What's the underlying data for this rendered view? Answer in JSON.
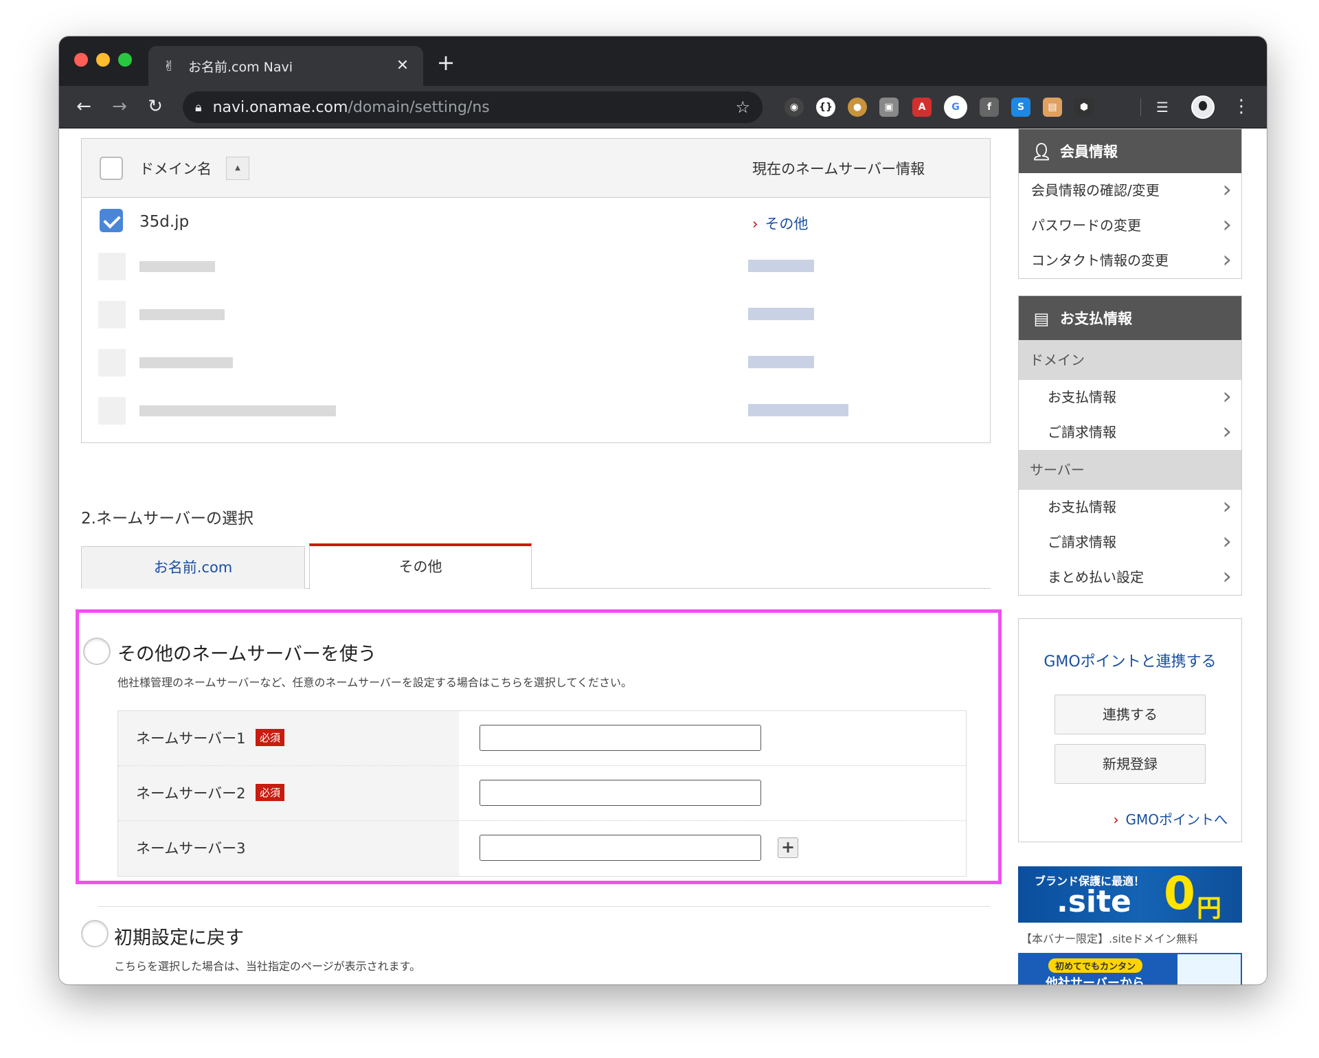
{
  "browser": {
    "tab_title": "お名前.com Navi",
    "tab_close": "✕",
    "new_tab": "+",
    "url_host": "navi.onamae.com",
    "url_path": "/domain/setting/ns",
    "extensions": [
      "adblock-icon",
      "code-icon",
      "cookie-icon",
      "screen-icon",
      "angular-icon",
      "google-icon",
      "facebook-icon",
      "stylus-icon",
      "reader-icon",
      "shield-icon"
    ]
  },
  "domain_table": {
    "col_domain": "ドメイン名",
    "col_ns": "現在のネームサーバー情報",
    "rows": [
      {
        "name": "35d.jp",
        "ns": "その他",
        "checked": true
      }
    ]
  },
  "section2": {
    "title": "2.ネームサーバーの選択",
    "tabs": [
      "お名前.com",
      "その他"
    ],
    "option_other": {
      "title": "その他のネームサーバーを使う",
      "desc": "他社様管理のネームサーバーなど、任意のネームサーバーを設定する場合はこちらを選択してください。"
    },
    "ns_rows": [
      {
        "label": "ネームサーバー1",
        "badge": "必須",
        "value": ""
      },
      {
        "label": "ネームサーバー2",
        "badge": "必須",
        "value": ""
      },
      {
        "label": "ネームサーバー3",
        "badge": "",
        "value": ""
      }
    ],
    "option_default": {
      "title": "初期設定に戻す",
      "desc": "こちらを選択した場合は、当社指定のページが表示されます。"
    }
  },
  "sidebar": {
    "member": {
      "title": "会員情報",
      "links": [
        "会員情報の確認/変更",
        "パスワードの変更",
        "コンタクト情報の変更"
      ]
    },
    "payment": {
      "title": "お支払情報",
      "groups": [
        {
          "label": "ドメイン",
          "links": [
            "お支払情報",
            "ご請求情報"
          ]
        },
        {
          "label": "サーバー",
          "links": [
            "お支払情報",
            "ご請求情報",
            "まとめ払い設定"
          ]
        }
      ]
    },
    "gmo": {
      "title": "GMOポイントと連携する",
      "btn_link": "連携する",
      "btn_register": "新規登録",
      "link": "GMOポイントへ"
    },
    "banner1": {
      "top": "ブランド保護に最適！",
      "site": ".site",
      "price": "0",
      "yen": "円",
      "caption": "【本バナー限定】.siteドメイン無料"
    },
    "banner2": {
      "tag": "初めてでもカンタン",
      "main": "他社サーバーから"
    }
  }
}
